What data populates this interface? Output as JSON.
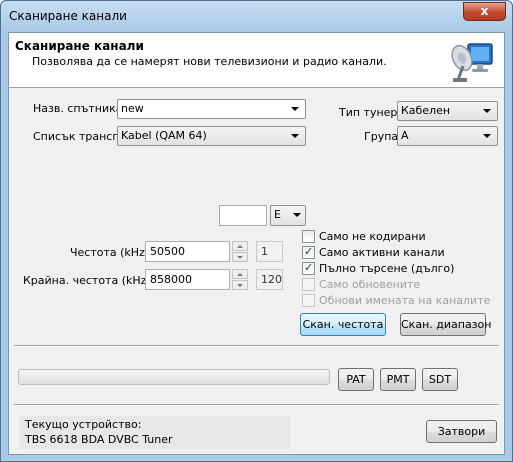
{
  "window": {
    "title": "Сканиране канали",
    "close_glyph": "x"
  },
  "header": {
    "title": "Сканиране канали",
    "subtitle": "Позволява да се намерят нови телевизиони и радио канали.",
    "icon": "satellite-dish-monitor-icon"
  },
  "form": {
    "sat_name_label": "Назв. спътника",
    "sat_name_value": "new",
    "transp_list_label": "Списък трансп.",
    "transp_list_value": "Kabel (QAM 64)",
    "tuner_type_label": "Тип тунер",
    "tuner_type_value": "Кабелен",
    "group_label": "Група",
    "group_value": "A",
    "position_value": "",
    "direction_value": "E",
    "frequency_label": "Честота (kHz)",
    "frequency_value": "50500",
    "frequency_counter": "1",
    "end_frequency_label": "Крайна. честота (kHz)",
    "end_frequency_value": "858000",
    "end_frequency_counter": "120"
  },
  "options": [
    {
      "label": "Само не кодирани",
      "checked": false,
      "disabled": false
    },
    {
      "label": "Само активни канали",
      "checked": true,
      "disabled": false
    },
    {
      "label": "Пълно търсене (дълго)",
      "checked": true,
      "disabled": false
    },
    {
      "label": "Само обновените",
      "checked": false,
      "disabled": true
    },
    {
      "label": "Обнови имената на каналите",
      "checked": false,
      "disabled": true
    }
  ],
  "buttons": {
    "scan_frequency": "Скан. честота",
    "scan_range": "Скан. диапазон",
    "pat": "PAT",
    "pmt": "PMT",
    "sdt": "SDT",
    "close": "Затвори"
  },
  "progress": {
    "value": 0
  },
  "device": {
    "label": "Текущо устройство:",
    "name": "TBS 6618 BDA DVBC Tuner"
  },
  "colors": {
    "titlebar": "#a9c9e6",
    "client_bg": "#f0f0f0",
    "close_button": "#c74a32",
    "focus_button": "#bee6fd"
  }
}
